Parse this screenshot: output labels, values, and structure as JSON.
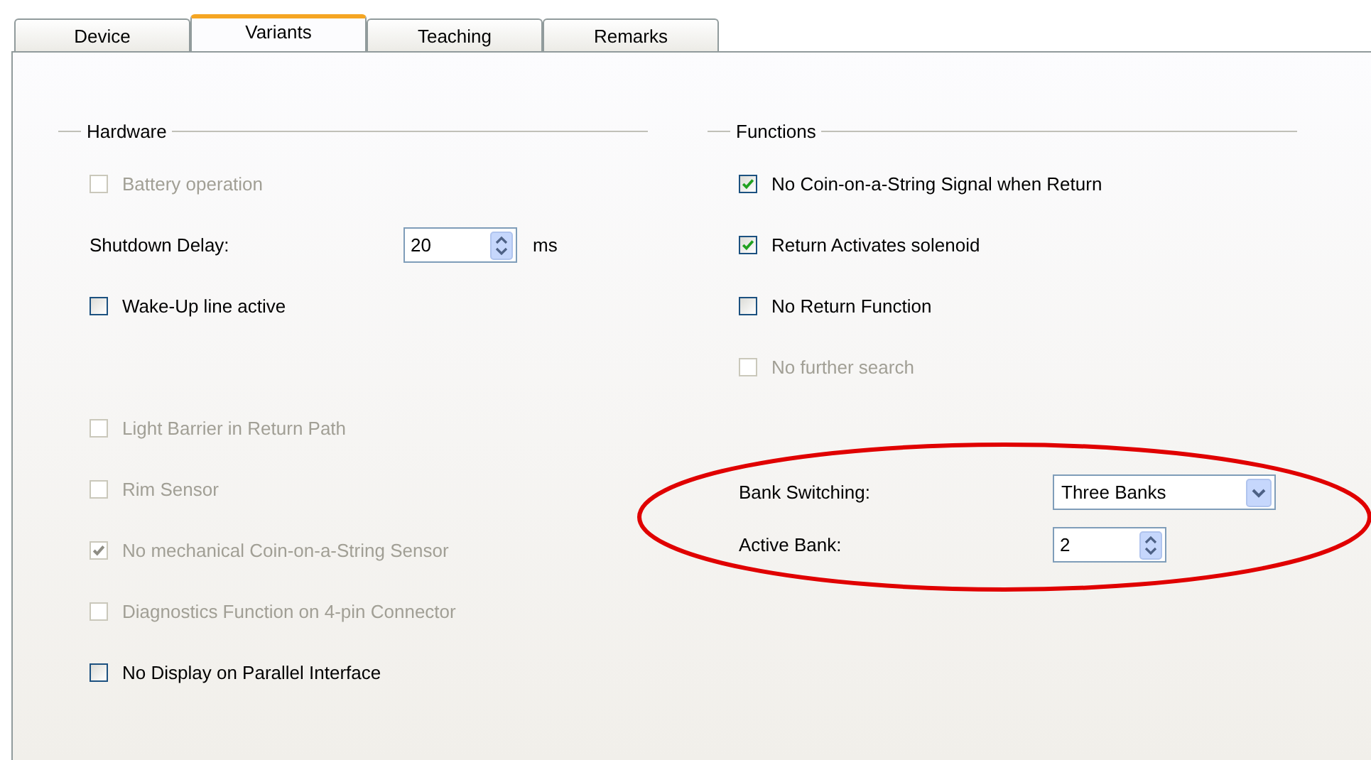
{
  "tabs": [
    {
      "label": "Device",
      "selected": false
    },
    {
      "label": "Variants",
      "selected": true
    },
    {
      "label": "Teaching",
      "selected": false
    },
    {
      "label": "Remarks",
      "selected": false
    }
  ],
  "hardware": {
    "title": "Hardware",
    "items": [
      {
        "kind": "checkbox",
        "label": "Battery operation",
        "checked": false,
        "disabled": true
      },
      {
        "kind": "spinner",
        "label": "Shutdown Delay:",
        "value": "20",
        "unit": "ms"
      },
      {
        "kind": "checkbox",
        "label": "Wake-Up line active",
        "checked": false,
        "disabled": false
      },
      {
        "kind": "checkbox",
        "label": "Light Barrier in Return Path",
        "checked": false,
        "disabled": true
      },
      {
        "kind": "checkbox",
        "label": "Rim Sensor",
        "checked": false,
        "disabled": true
      },
      {
        "kind": "checkbox",
        "label": "No mechanical Coin-on-a-String Sensor",
        "checked": true,
        "disabled": true
      },
      {
        "kind": "checkbox",
        "label": "Diagnostics Function on 4-pin Connector",
        "checked": false,
        "disabled": true
      },
      {
        "kind": "checkbox",
        "label": "No Display on Parallel Interface",
        "checked": false,
        "disabled": false
      }
    ]
  },
  "functions": {
    "title": "Functions",
    "items": [
      {
        "kind": "checkbox",
        "label": "No Coin-on-a-String Signal when Return",
        "checked": true,
        "disabled": false
      },
      {
        "kind": "checkbox",
        "label": "Return Activates solenoid",
        "checked": true,
        "disabled": false
      },
      {
        "kind": "checkbox",
        "label": "No Return Function",
        "checked": false,
        "disabled": false
      },
      {
        "kind": "checkbox",
        "label": "No further search",
        "checked": false,
        "disabled": true
      }
    ]
  },
  "banks": [
    {
      "kind": "dropdown",
      "label": "Bank Switching:",
      "value": "Three Banks"
    },
    {
      "kind": "spinner",
      "label": "Active Bank:",
      "value": "2"
    }
  ],
  "annotation": {
    "kind": "ellipse",
    "color": "#e00000"
  }
}
